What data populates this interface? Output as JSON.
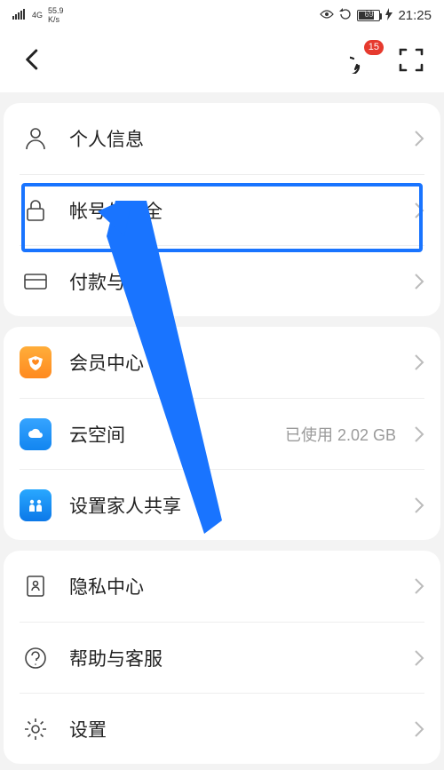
{
  "statusbar": {
    "net_label": "4G",
    "speed_top": "55.9",
    "speed_bottom": "K/s",
    "battery_pct": "69",
    "time": "21:25"
  },
  "navbar": {
    "badge_count": "15"
  },
  "sections": [
    {
      "rows": [
        {
          "key": "profile",
          "label": "个人信息"
        },
        {
          "key": "security",
          "label": "帐号与安全"
        },
        {
          "key": "payment",
          "label": "付款与账单"
        }
      ]
    },
    {
      "rows": [
        {
          "key": "member",
          "label": "会员中心"
        },
        {
          "key": "cloud",
          "label": "云空间",
          "value": "已使用 2.02 GB"
        },
        {
          "key": "family",
          "label": "设置家人共享"
        }
      ]
    },
    {
      "rows": [
        {
          "key": "privacy",
          "label": "隐私中心"
        },
        {
          "key": "help",
          "label": "帮助与客服"
        },
        {
          "key": "settings",
          "label": "设置"
        }
      ]
    }
  ],
  "highlight": {
    "target": "security"
  }
}
